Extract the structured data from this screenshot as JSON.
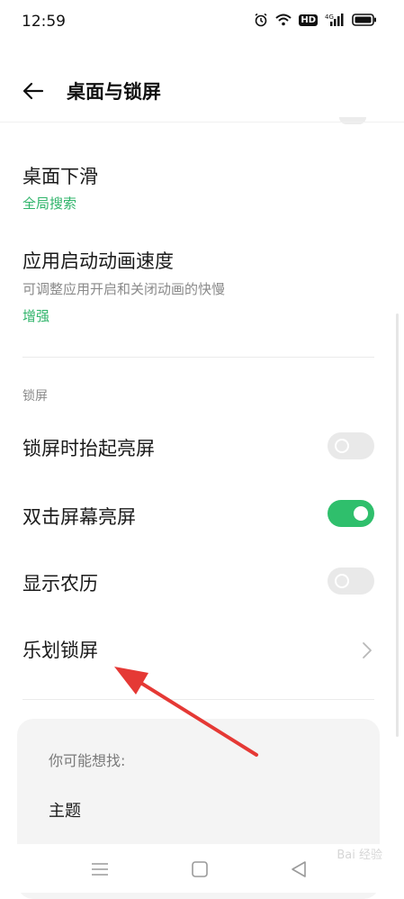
{
  "status_bar": {
    "time": "12:59",
    "hd_badge": "HD",
    "network": "4G"
  },
  "header": {
    "title": "桌面与锁屏"
  },
  "rows": {
    "desktop_swipe": {
      "title": "桌面下滑",
      "value": "全局搜索"
    },
    "animation_speed": {
      "title": "应用启动动画速度",
      "subtitle": "可调整应用开启和关闭动画的快慢",
      "value": "增强"
    }
  },
  "lock_section": {
    "label": "锁屏",
    "items": [
      {
        "label": "锁屏时抬起亮屏",
        "enabled": false
      },
      {
        "label": "双击屏幕亮屏",
        "enabled": true
      },
      {
        "label": "显示农历",
        "enabled": false
      }
    ],
    "lock_screen_link": "乐划锁屏"
  },
  "suggestions": {
    "title": "你可能想找:",
    "items": [
      "主题"
    ]
  },
  "watermark": "Bai 经验",
  "colors": {
    "accent_green": "#2fbf6c",
    "link_green": "#2fb46a",
    "annotation_arrow": "#e53935"
  }
}
